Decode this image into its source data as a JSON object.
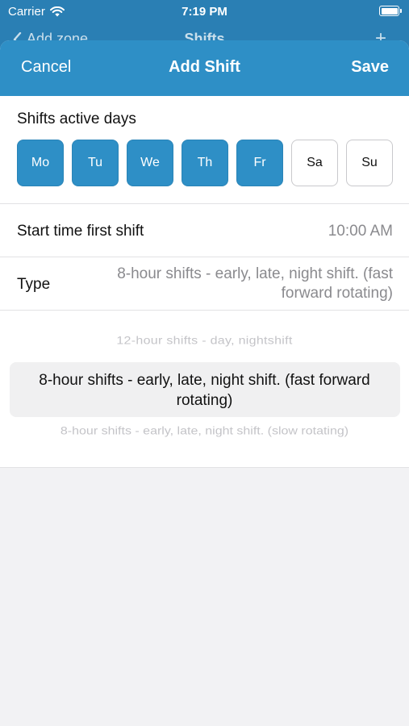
{
  "status": {
    "carrier": "Carrier",
    "time": "7:19 PM"
  },
  "background_nav": {
    "back_label": "Add zone",
    "title": "Shifts",
    "action": "+"
  },
  "sheet": {
    "cancel": "Cancel",
    "title": "Add Shift",
    "save": "Save",
    "accent_color": "#2e8fc6"
  },
  "days": {
    "label": "Shifts active days",
    "items": [
      {
        "label": "Mo",
        "selected": true
      },
      {
        "label": "Tu",
        "selected": true
      },
      {
        "label": "We",
        "selected": true
      },
      {
        "label": "Th",
        "selected": true
      },
      {
        "label": "Fr",
        "selected": true
      },
      {
        "label": "Sa",
        "selected": false
      },
      {
        "label": "Su",
        "selected": false
      }
    ]
  },
  "start_time": {
    "label": "Start time first shift",
    "value": "10:00 AM"
  },
  "type": {
    "label": "Type",
    "value": "8-hour shifts - early, late, night shift. (fast forward rotating)"
  },
  "picker": {
    "options": [
      "12-hour shifts - day, nightshift",
      "8-hour shifts - early, late, night shift. (fast forward rotating)",
      "8-hour shifts - early, late, night shift. (slow rotating)"
    ]
  }
}
